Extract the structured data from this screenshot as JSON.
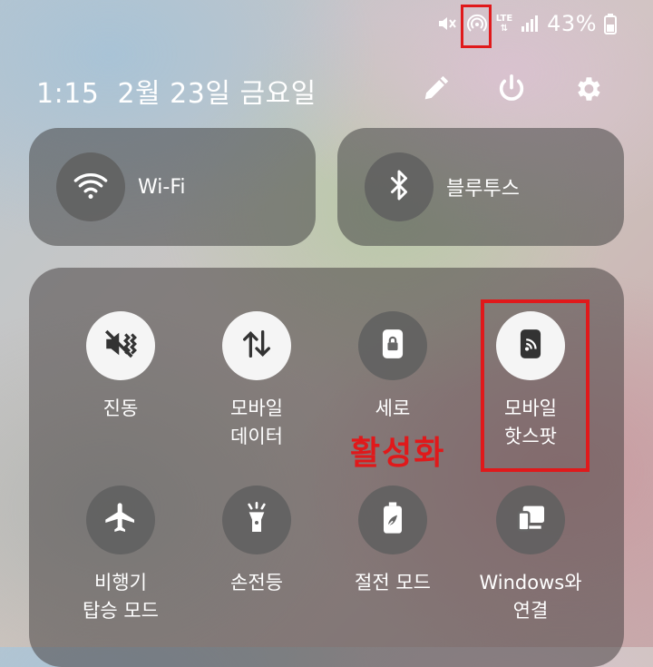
{
  "status_bar": {
    "battery_text": "43%",
    "network_label": "LTE",
    "icons": [
      "mute-icon",
      "hotspot-icon",
      "lte-icon",
      "signal-icon",
      "battery-icon"
    ]
  },
  "header": {
    "time": "1:15",
    "date": "2월 23일 금요일"
  },
  "big_tiles": [
    {
      "label": "Wi-Fi",
      "icon": "wifi-icon",
      "active": false
    },
    {
      "label": "블루투스",
      "icon": "bluetooth-icon",
      "active": false
    }
  ],
  "tiles": [
    {
      "label": "진동",
      "icon": "vibrate-icon",
      "active": true
    },
    {
      "label": "모바일\n데이터",
      "icon": "mobile-data-icon",
      "active": true
    },
    {
      "label": "세로",
      "icon": "portrait-lock-icon",
      "active": false
    },
    {
      "label": "모바일\n핫스팟",
      "icon": "mobile-hotspot-icon",
      "active": true
    },
    {
      "label": "비행기\n탑승 모드",
      "icon": "airplane-icon",
      "active": false
    },
    {
      "label": "손전등",
      "icon": "flashlight-icon",
      "active": false
    },
    {
      "label": "절전 모드",
      "icon": "power-saving-icon",
      "active": false
    },
    {
      "label": "Windows와\n연결",
      "icon": "link-to-windows-icon",
      "active": false
    }
  ],
  "annotation": {
    "text": "활성화",
    "color": "#e0191b"
  },
  "colors": {
    "tile_active": "#f5f5f5",
    "tile_inactive": "#5f5f5f",
    "highlight": "#e0191b"
  }
}
